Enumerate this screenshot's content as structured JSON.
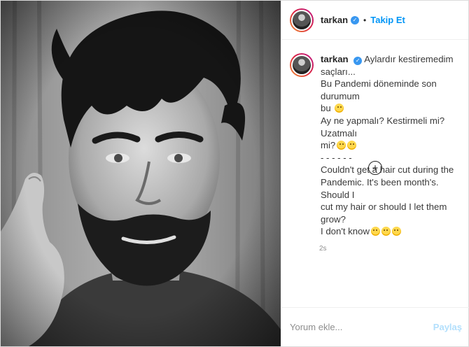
{
  "media": {
    "icon": "selfie-photo"
  },
  "header": {
    "username": "tarkan",
    "separator": "•",
    "follow_label": "Takip Et",
    "verified_icon": "check-icon"
  },
  "caption": {
    "username": "tarkan",
    "lines": [
      "Aylardır kestiremedim",
      "saçları...",
      "Bu Pandemi döneminde son durumum",
      "bu",
      "Ay ne yapmalı? Kestirmeli mi? Uzatmalı",
      "mi?",
      "- - - - - -",
      "Couldn't get a hair cut during the",
      "Pandemic. It's been month's. Should I",
      "cut my hair or should I let them grow?",
      "I don't know"
    ],
    "time": "2s"
  },
  "load_more": {
    "icon": "plus-circle-icon"
  },
  "add_comment": {
    "placeholder": "Yorum ekle...",
    "post_label": "Paylaş"
  },
  "colors": {
    "accent": "#0095f6",
    "verified": "#3897f0",
    "post_disabled": "#b2dffc"
  }
}
